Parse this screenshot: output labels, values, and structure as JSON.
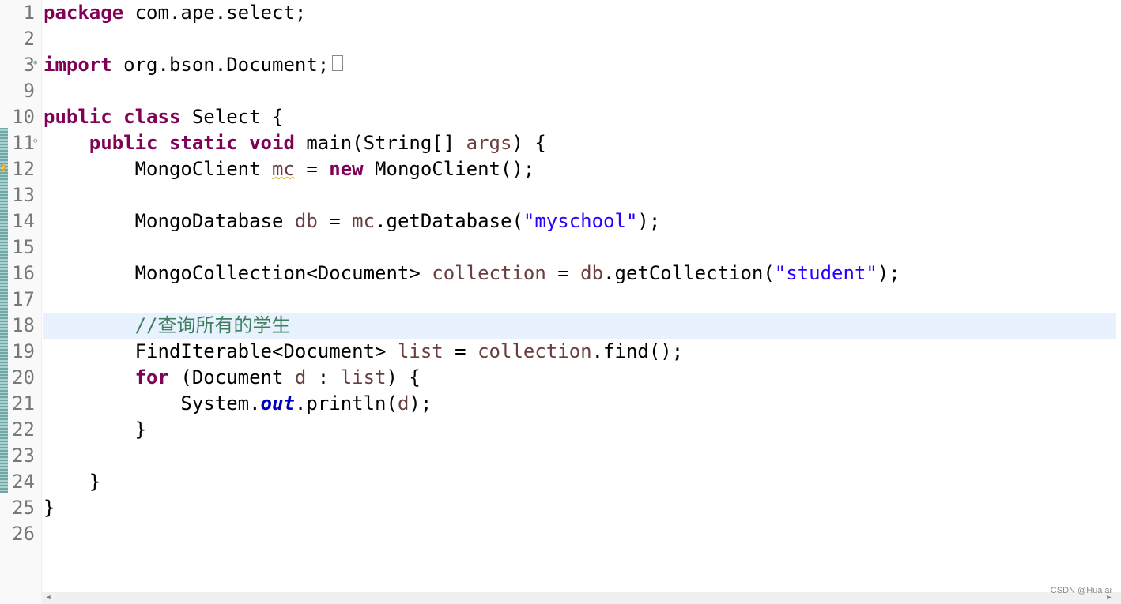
{
  "editor": {
    "lines": [
      {
        "n": "1"
      },
      {
        "n": "2"
      },
      {
        "n": "3"
      },
      {
        "n": "9"
      },
      {
        "n": "10"
      },
      {
        "n": "11"
      },
      {
        "n": "12"
      },
      {
        "n": "13"
      },
      {
        "n": "14"
      },
      {
        "n": "15"
      },
      {
        "n": "16"
      },
      {
        "n": "17"
      },
      {
        "n": "18"
      },
      {
        "n": "19"
      },
      {
        "n": "20"
      },
      {
        "n": "21"
      },
      {
        "n": "22"
      },
      {
        "n": "23"
      },
      {
        "n": "24"
      },
      {
        "n": "25"
      },
      {
        "n": "26"
      }
    ],
    "tokens": {
      "package": "package",
      "package_name": " com.ape.select;",
      "import": "import",
      "import_name": " org.bson.Document;",
      "public": "public",
      "class": "class",
      "class_name": " Select {",
      "static": "static",
      "void": "void",
      "main_sig": " main(String[] ",
      "args": "args",
      "main_end": ") {",
      "mongo_client_type": "MongoClient ",
      "mc": "mc",
      "assign": " = ",
      "new": "new",
      "mongo_client_ctor": " MongoClient();",
      "mongo_db_type": "MongoDatabase ",
      "db": "db",
      "mc_ref": "mc",
      "get_database": ".getDatabase(",
      "myschool": "\"myschool\"",
      "close_stmt": ");",
      "mongo_coll_type": "MongoCollection<Document> ",
      "collection": "collection",
      "db_ref": "db",
      "get_collection": ".getCollection(",
      "student": "\"student\"",
      "comment": "//查询所有的学生",
      "find_iter_type": "FindIterable<Document> ",
      "list": "list",
      "collection_ref": "collection",
      "find_call": ".find();",
      "for": "for",
      "for_open": " (Document ",
      "d": "d",
      "colon": " : ",
      "list_ref": "list",
      "for_close": ") {",
      "system": "System.",
      "out": "out",
      "println": ".println(",
      "d_ref": "d",
      "close_brace": "}"
    }
  },
  "watermark": "CSDN @Hua ai",
  "icons": {
    "fold_expand": "fold-expand-icon",
    "fold_collapse": "fold-collapse-icon",
    "warning": "warning-marker-icon"
  },
  "colors": {
    "keyword": "#7f0055",
    "string": "#2a00ff",
    "local_variable": "#6a3e3e",
    "comment": "#3f7f5f",
    "field": "#0000c0",
    "current_line": "#e8f2fe"
  }
}
